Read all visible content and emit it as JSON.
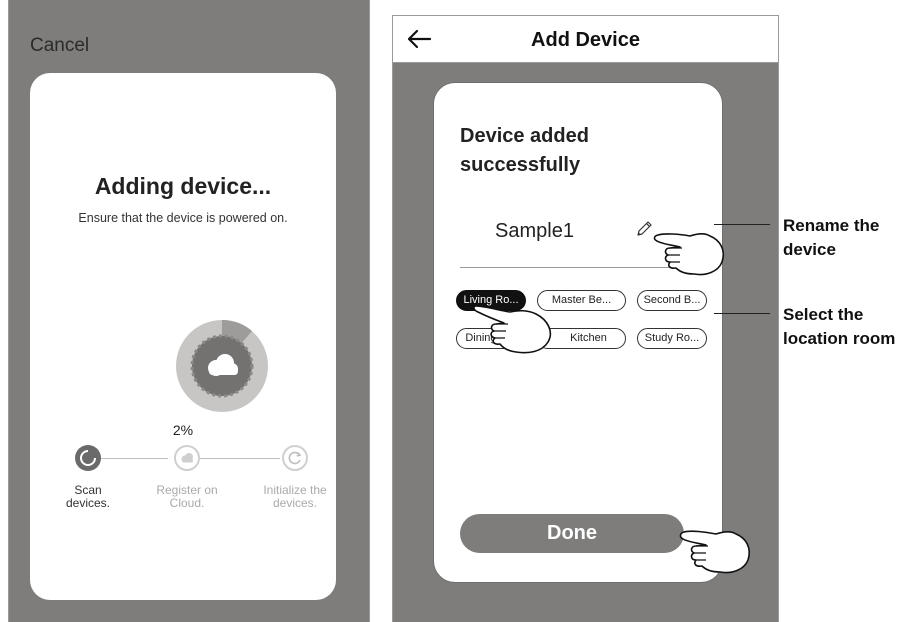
{
  "adding_screen": {
    "cancel_label": "Cancel",
    "title": "Adding device...",
    "subtitle": "Ensure that the device is powered on.",
    "progress_text": "2%",
    "progress_fraction": 0.02,
    "steps": [
      {
        "label_line1": "Scan",
        "label_line2": "devices.",
        "icon": "refresh-icon",
        "state": "active"
      },
      {
        "label_line1": "Register on",
        "label_line2": "Cloud.",
        "icon": "cloud-icon",
        "state": "pending"
      },
      {
        "label_line1": "Initialize the",
        "label_line2": "devices.",
        "icon": "reload-icon",
        "state": "pending"
      }
    ]
  },
  "add_device_screen": {
    "header_title": "Add Device",
    "success_line1": "Device added",
    "success_line2": "successfully",
    "device_name": "Sample1",
    "rooms": [
      {
        "label": "Living Ro...",
        "selected": true
      },
      {
        "label": "Master Be...",
        "selected": false
      },
      {
        "label": "Second B...",
        "selected": false
      },
      {
        "label": "Dining R...",
        "selected": false
      },
      {
        "label": "Kitchen",
        "selected": false
      },
      {
        "label": "Study Ro...",
        "selected": false
      }
    ],
    "done_label": "Done"
  },
  "annotations": {
    "rename_line1": "Rename the",
    "rename_line2": "device",
    "select_line1": "Select the",
    "select_line2": "location room"
  },
  "colors": {
    "phone_background": "#7e7d7b",
    "card_background": "#ffffff",
    "active_step": "#6a6a6a",
    "pending_step": "#cfcfcf",
    "progress_ring_outer": "#c7c6c4",
    "progress_ring_inner": "#737271",
    "selected_chip": "#111111",
    "done_button": "#7e7d7b"
  }
}
